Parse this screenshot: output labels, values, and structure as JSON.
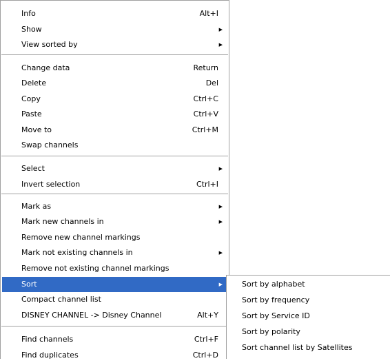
{
  "context_menu": {
    "items": [
      {
        "label": "Info",
        "shortcut": "Alt+I"
      },
      {
        "label": "Show",
        "submenu": "▶"
      },
      {
        "label": "View sorted by",
        "submenu": "▶"
      },
      {
        "label": "Change data",
        "shortcut": "Return"
      },
      {
        "label": "Delete",
        "shortcut": "Del"
      },
      {
        "label": "Copy",
        "shortcut": "Ctrl+C"
      },
      {
        "label": "Paste",
        "shortcut": "Ctrl+V"
      },
      {
        "label": "Move to",
        "shortcut": "Ctrl+M"
      },
      {
        "label": "Swap channels"
      },
      {
        "label": "Select",
        "submenu": "▶"
      },
      {
        "label": "Invert selection",
        "shortcut": "Ctrl+I"
      },
      {
        "label": "Mark as",
        "submenu": "▶"
      },
      {
        "label": "Mark new channels in",
        "submenu": "▶"
      },
      {
        "label": "Remove new channel markings"
      },
      {
        "label": "Mark not existing channels in",
        "submenu": "▶"
      },
      {
        "label": "Remove not existing channel markings"
      },
      {
        "label": "Sort",
        "submenu": "▶",
        "highlighted": true
      },
      {
        "label": "Compact channel list"
      },
      {
        "label": "DISNEY CHANNEL -> Disney Channel",
        "shortcut": "Alt+Y"
      },
      {
        "label": "Find channels",
        "shortcut": "Ctrl+F"
      },
      {
        "label": "Find duplicates",
        "shortcut": "Ctrl+D"
      }
    ]
  },
  "sort_submenu": {
    "items": [
      {
        "label": "Sort by alphabet"
      },
      {
        "label": "Sort by frequency"
      },
      {
        "label": "Sort by Service ID"
      },
      {
        "label": "Sort by polarity"
      },
      {
        "label": "Sort channel list by Satellites"
      }
    ]
  },
  "colors": {
    "highlight": "#316ac5",
    "border": "#a0a0a0",
    "background": "#ffffff"
  }
}
